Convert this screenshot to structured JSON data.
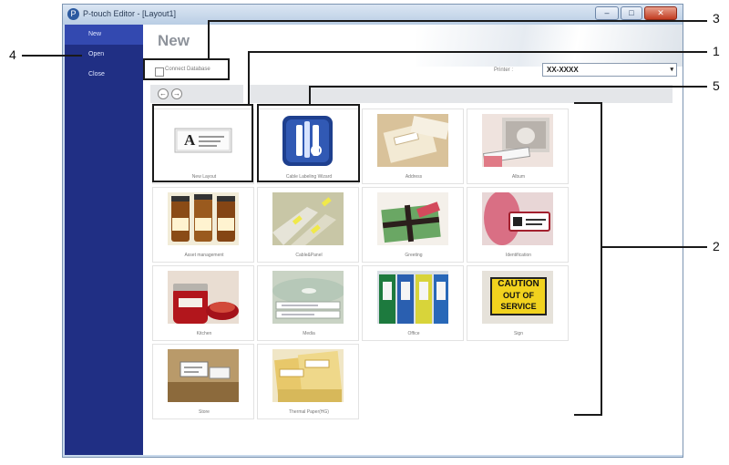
{
  "window": {
    "title": "P-touch Editor - [Layout1]",
    "min_symbol": "–",
    "max_symbol": "□",
    "close_symbol": "✕",
    "app_icon_symbol": "P"
  },
  "sidebar": {
    "items": [
      {
        "label": "New",
        "active": true
      },
      {
        "label": "Open",
        "active": false
      },
      {
        "label": "Close",
        "active": false
      }
    ]
  },
  "main": {
    "title": "New",
    "connect_database_label": "Connect Database",
    "printer_label": "Printer :",
    "printer_value": "XX-XXXX",
    "printer_arrow": "▾",
    "back_symbol": "←",
    "forward_symbol": "→"
  },
  "templates": [
    {
      "label": "New Layout"
    },
    {
      "label": "Cable Labeling Wizard"
    },
    {
      "label": "Address"
    },
    {
      "label": "Album"
    },
    {
      "label": "Asset management"
    },
    {
      "label": "Cable&Panel"
    },
    {
      "label": "Greeting"
    },
    {
      "label": "Identification"
    },
    {
      "label": "Kitchen"
    },
    {
      "label": "Media"
    },
    {
      "label": "Office"
    },
    {
      "label": "Sign"
    },
    {
      "label": "Store"
    },
    {
      "label": "Thermal Paper(HG)"
    }
  ],
  "images": {
    "new_layout_letter": "A",
    "caution_line1": "CAUTION",
    "caution_line2": "OUT OF",
    "caution_line3": "SERVICE"
  },
  "callouts": {
    "n1": "1",
    "n2": "2",
    "n3": "3",
    "n4": "4",
    "n5": "5"
  },
  "colors": {
    "sidebar": "#202f84",
    "sidebar_active": "#3349b0",
    "window_frame": "#c9d9ec"
  }
}
